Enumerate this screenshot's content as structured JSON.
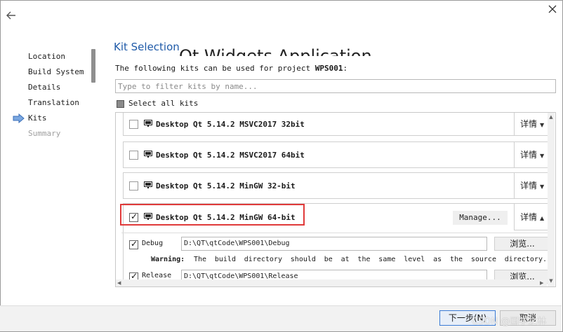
{
  "wizard": {
    "title": "Kit Selection",
    "ghost_title": "Qt Widgets Application",
    "description_prefix": "The following kits can be used for project ",
    "project_name": "WPS001",
    "description_suffix": ":",
    "filter_placeholder": "Type to filter kits by name...",
    "select_all_label": "Select all kits"
  },
  "sidebar": {
    "items": [
      {
        "label": "Location"
      },
      {
        "label": "Build System"
      },
      {
        "label": "Details"
      },
      {
        "label": "Translation"
      },
      {
        "label": "Kits"
      },
      {
        "label": "Summary"
      }
    ],
    "active_index": 4
  },
  "kits": [
    {
      "label": "Desktop Qt 5.14.2 MSVC2017 32bit",
      "checked": false,
      "details_label": "详情"
    },
    {
      "label": "Desktop Qt 5.14.2 MSVC2017 64bit",
      "checked": false,
      "details_label": "详情"
    },
    {
      "label": "Desktop Qt 5.14.2 MinGW 32-bit",
      "checked": false,
      "details_label": "详情"
    },
    {
      "label": "Desktop Qt 5.14.2 MinGW 64-bit",
      "checked": true,
      "details_label": "详情",
      "manage_label": "Manage..."
    }
  ],
  "build_configs": {
    "debug": {
      "label": "Debug",
      "checked": true,
      "path": "D:\\QT\\qtCode\\WPS001\\Debug",
      "browse_label": "浏览..."
    },
    "warning_label": "Warning:",
    "warning_text": "The build directory should be at the same level as the source directory.",
    "release": {
      "label": "Release",
      "checked": true,
      "path": "D:\\QT\\qtCode\\WPS001\\Release",
      "browse_label": "浏览..."
    }
  },
  "footer": {
    "next_label": "下一步(N)",
    "cancel_label": "取消",
    "watermark": "CSDN @国学之林"
  },
  "colors": {
    "accent": "#1f5aa8",
    "highlight_box": "#e03a3a",
    "primary_button_border": "#3a7bd5"
  }
}
